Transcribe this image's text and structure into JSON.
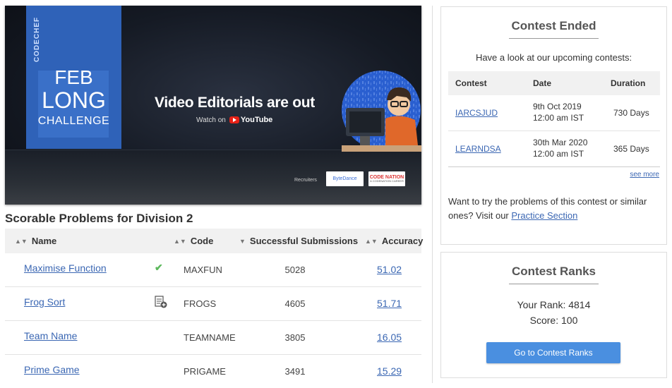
{
  "banner": {
    "brand": "CODECHEF",
    "title_line1": "FEB",
    "title_line2": "LONG",
    "title_line3": "CHALLENGE",
    "headline": "Video Editorials are out",
    "watch_on": "Watch on",
    "youtube": "YouTube",
    "recruiters_label": "Recruiters",
    "recruiter1": "ByteDance",
    "recruiter2": "CODE NATION",
    "recruiter2_tagline": "A CODENATION CAREER"
  },
  "problems": {
    "title": "Scorable Problems for Division 2",
    "headers": {
      "name": "Name",
      "code": "Code",
      "submissions": "Successful Submissions",
      "accuracy": "Accuracy"
    },
    "rows": [
      {
        "name": "Maximise Function",
        "status": "solved",
        "code": "MAXFUN",
        "submissions": "5028",
        "accuracy": "51.02"
      },
      {
        "name": "Frog Sort",
        "status": "attempted",
        "code": "FROGS",
        "submissions": "4605",
        "accuracy": "51.71"
      },
      {
        "name": "Team Name",
        "status": "",
        "code": "TEAMNAME",
        "submissions": "3805",
        "accuracy": "16.05"
      },
      {
        "name": "Prime Game",
        "status": "",
        "code": "PRIGAME",
        "submissions": "3491",
        "accuracy": "15.29"
      }
    ]
  },
  "contest_ended": {
    "title": "Contest Ended",
    "subtitle": "Have a look at our upcoming contests:",
    "headers": {
      "contest": "Contest",
      "date": "Date",
      "duration": "Duration"
    },
    "rows": [
      {
        "contest": "IARCSJUD",
        "date_line1": "9th Oct 2019",
        "date_line2": "12:00 am IST",
        "duration": "730 Days"
      },
      {
        "contest": "LEARNDSA",
        "date_line1": "30th Mar 2020",
        "date_line2": "12:00 am IST",
        "duration": "365 Days"
      }
    ],
    "see_more": "see more",
    "practice_text": "Want to try the problems of this contest or similar ones? Visit our",
    "practice_link": "Practice Section"
  },
  "contest_ranks": {
    "title": "Contest Ranks",
    "your_rank": "Your Rank: 4814",
    "score": "Score: 100",
    "button": "Go to Contest Ranks"
  },
  "colors": {
    "link": "#3b67b3",
    "button": "#4a8fe0",
    "banner_blue": "#2f62b8",
    "check": "#5cb85c"
  },
  "icons": {
    "solved": "check-icon",
    "attempted": "partial-submission-icon",
    "sort": "sort-icon"
  }
}
